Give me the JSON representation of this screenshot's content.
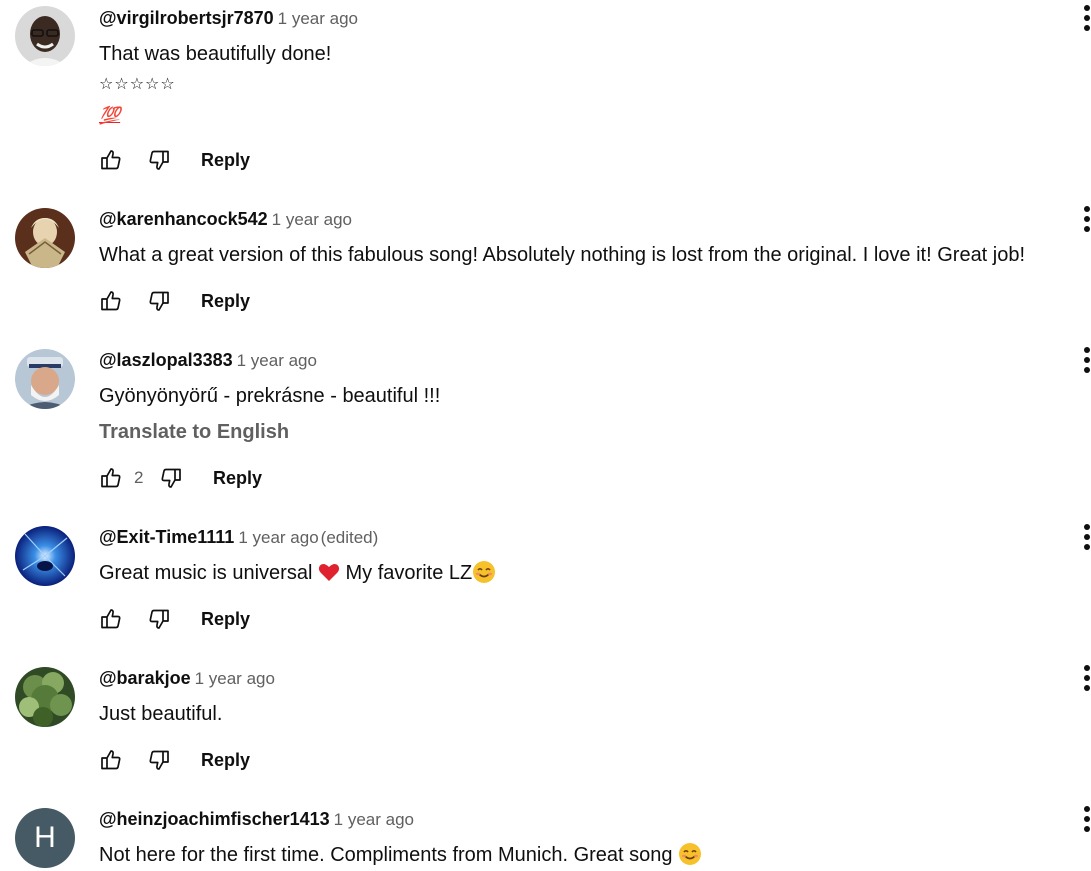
{
  "reply_label": "Reply",
  "translate_label": "Translate to English",
  "colors": {
    "text": "#0f0f0f",
    "secondary": "#606060",
    "heart": "#e02130",
    "smile": "#f7c12b",
    "letter_avatar_bg": "#455a64"
  },
  "comments": [
    {
      "author": "@virgilrobertsjr7870",
      "time": "1 year ago",
      "lines": [
        "That was beautifully done!",
        "☆☆☆☆☆",
        "💯"
      ],
      "avatar": "photo-man-glasses"
    },
    {
      "author": "@karenhancock542",
      "time": "1 year ago",
      "lines": [
        "What a great version of this fabulous song! Absolutely nothing is lost from the original.  I love it!  Great job!"
      ],
      "avatar": "photo-woman-fan"
    },
    {
      "author": "@laszlopal3383",
      "time": "1 year ago",
      "lines": [
        "Gyönyönyörű - prekrásne - beautiful !!!"
      ],
      "likes": "2",
      "avatar": "photo-man-cap"
    },
    {
      "author": "@Exit-Time1111",
      "time": "1 year ago",
      "edited": "(edited)",
      "text_a": "Great music is universal ",
      "text_b": "  My favorite LZ",
      "avatar": "photo-blue-light"
    },
    {
      "author": "@barakjoe",
      "time": "1 year ago",
      "lines": [
        "Just beautiful."
      ],
      "avatar": "photo-green-tree"
    },
    {
      "author": "@heinzjoachimfischer1413",
      "time": "1 year ago",
      "text_a": "Not here for the first time. Compliments from Munich. Great song ",
      "avatar_letter": "H"
    }
  ]
}
